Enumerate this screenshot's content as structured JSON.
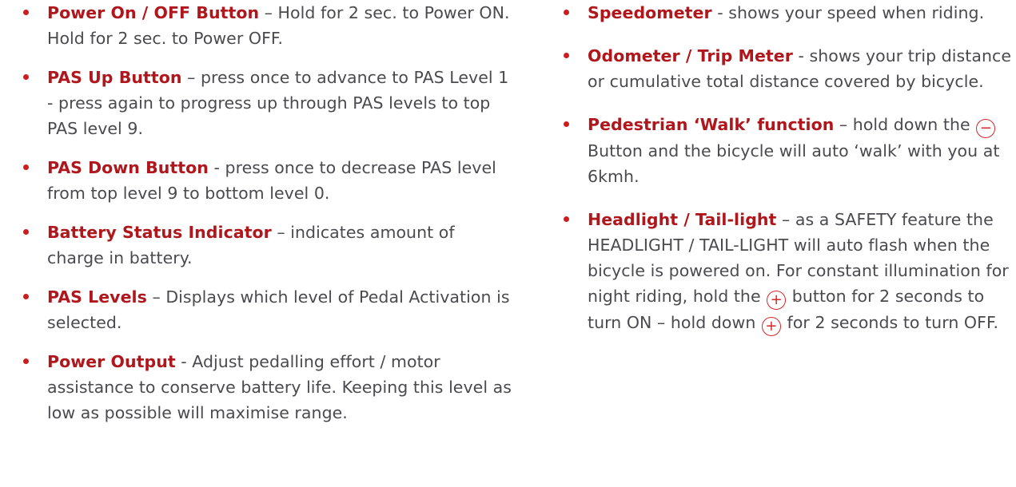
{
  "colors": {
    "bullet": "#cf1c1f",
    "term": "#b0171c",
    "body_text": "#4a4a4f",
    "icon": "#d5272a"
  },
  "left_column": [
    {
      "term": "Power On / OFF Button",
      "sep": " – ",
      "desc": "Hold for 2 sec. to Power ON. Hold for 2 sec. to Power OFF."
    },
    {
      "term": "PAS Up Button",
      "sep": " – ",
      "desc": "press once to advance to PAS Level 1 - press again to progress up through PAS levels to top PAS level 9."
    },
    {
      "term": "PAS Down Button",
      "sep": " - ",
      "desc": "press once to decrease PAS level from top level 9 to bottom level 0."
    },
    {
      "term": "Battery Status Indicator",
      "sep": " – ",
      "desc": "indicates amount of charge in battery."
    },
    {
      "term": "PAS Levels",
      "sep": " – ",
      "desc": "Displays which level of Pedal Activation is selected."
    },
    {
      "term": "Power Output",
      "sep": " - ",
      "desc": "Adjust pedalling effort / motor assistance to conserve battery life. Keeping this level as low as possible will maximise range."
    }
  ],
  "right_column": {
    "speedometer": {
      "term": "Speedometer",
      "sep": " - ",
      "desc": "shows your speed when riding."
    },
    "odometer": {
      "term": "Odometer / Trip Meter",
      "sep": " - ",
      "desc": "shows your trip distance or cumulative total distance covered by bicycle."
    },
    "walk": {
      "term": "Pedestrian ‘Walk’ function",
      "sep": " – ",
      "desc_1": "hold down the",
      "icon_symbol": "−",
      "icon_name": "minus-circle-icon",
      "desc_2": "Button and the bicycle will auto ‘walk’ with you at 6kmh."
    },
    "headlight": {
      "term": "Headlight / Tail-light",
      "sep": " – ",
      "desc_1": "as a SAFETY feature the HEADLIGHT / TAIL-LIGHT will auto flash when the bicycle is powered on. For constant illumination for night riding, hold the",
      "icon_symbol_1": "+",
      "icon_name_1": "plus-circle-icon",
      "desc_2": "button for 2 seconds to turn ON – hold down",
      "icon_symbol_2": "+",
      "icon_name_2": "plus-circle-icon",
      "desc_3": "for 2 seconds to turn OFF."
    }
  }
}
